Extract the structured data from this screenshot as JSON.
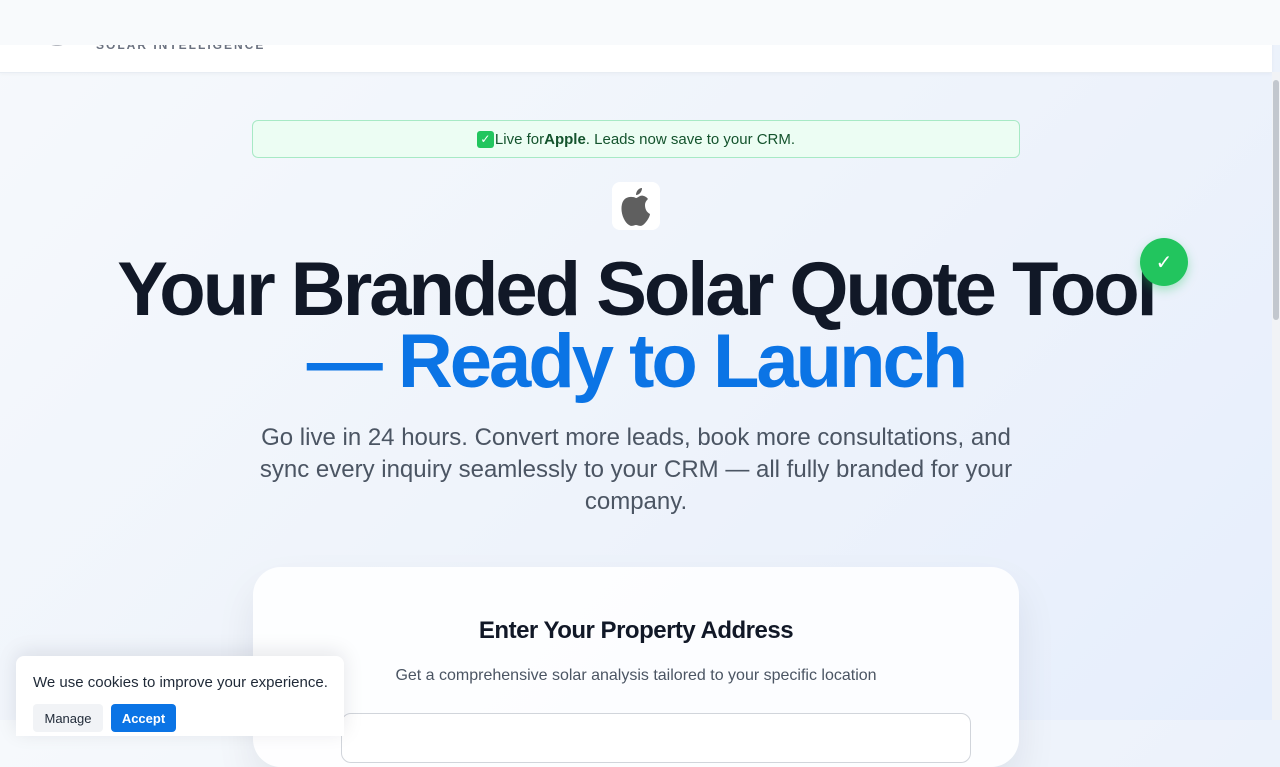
{
  "header": {
    "brand_tagline": "SOLAR INTELLIGENCE"
  },
  "banner": {
    "prefix": "Live for ",
    "company": "Apple",
    "suffix": ". Leads now save to your CRM."
  },
  "hero": {
    "line1": "Your Branded Solar Quote Tool",
    "line2": "— Ready to Launch",
    "subtext": "Go live in 24 hours. Convert more leads, book more consultations, and sync every inquiry seamlessly to your CRM — all fully branded for your company."
  },
  "card": {
    "title": "Enter Your Property Address",
    "subtitle": "Get a comprehensive solar analysis tailored to your specific location"
  },
  "cookie": {
    "message": "We use cookies to improve your experience.",
    "manage_label": "Manage",
    "accept_label": "Accept"
  },
  "icons": {
    "check": "check-icon",
    "apple_logo": "apple-logo-icon",
    "verified": "verified-check-icon"
  },
  "colors": {
    "accent": "#0b74e5",
    "success": "#22c55e"
  }
}
